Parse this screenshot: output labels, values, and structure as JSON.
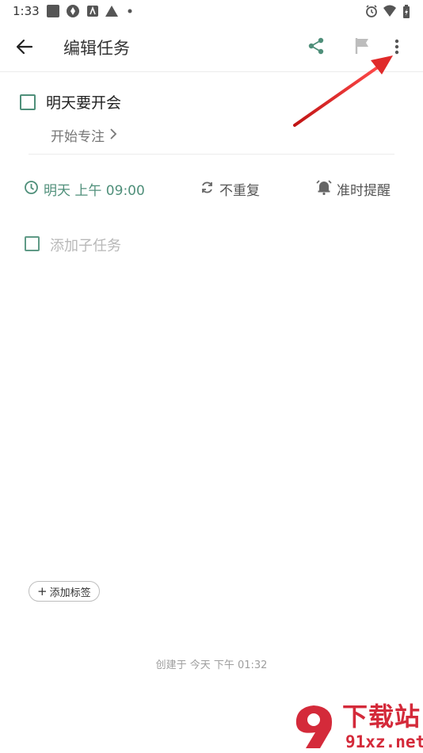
{
  "status_bar": {
    "time": "1:33"
  },
  "app_bar": {
    "title": "编辑任务"
  },
  "task": {
    "title": "明天要开会",
    "focus_label": "开始专注"
  },
  "meta": {
    "due": "明天 上午 09:00",
    "repeat": "不重复",
    "reminder": "准时提醒"
  },
  "subtask": {
    "placeholder": "添加子任务"
  },
  "tag": {
    "label": "添加标签"
  },
  "footer": {
    "created": "创建于 今天 下午 01:32"
  },
  "watermark": {
    "text": "下载站",
    "url": "91xz.net"
  },
  "colors": {
    "accent": "#4f8f7a",
    "annotation_arrow": "#d62020",
    "watermark": "#d42a3a"
  }
}
